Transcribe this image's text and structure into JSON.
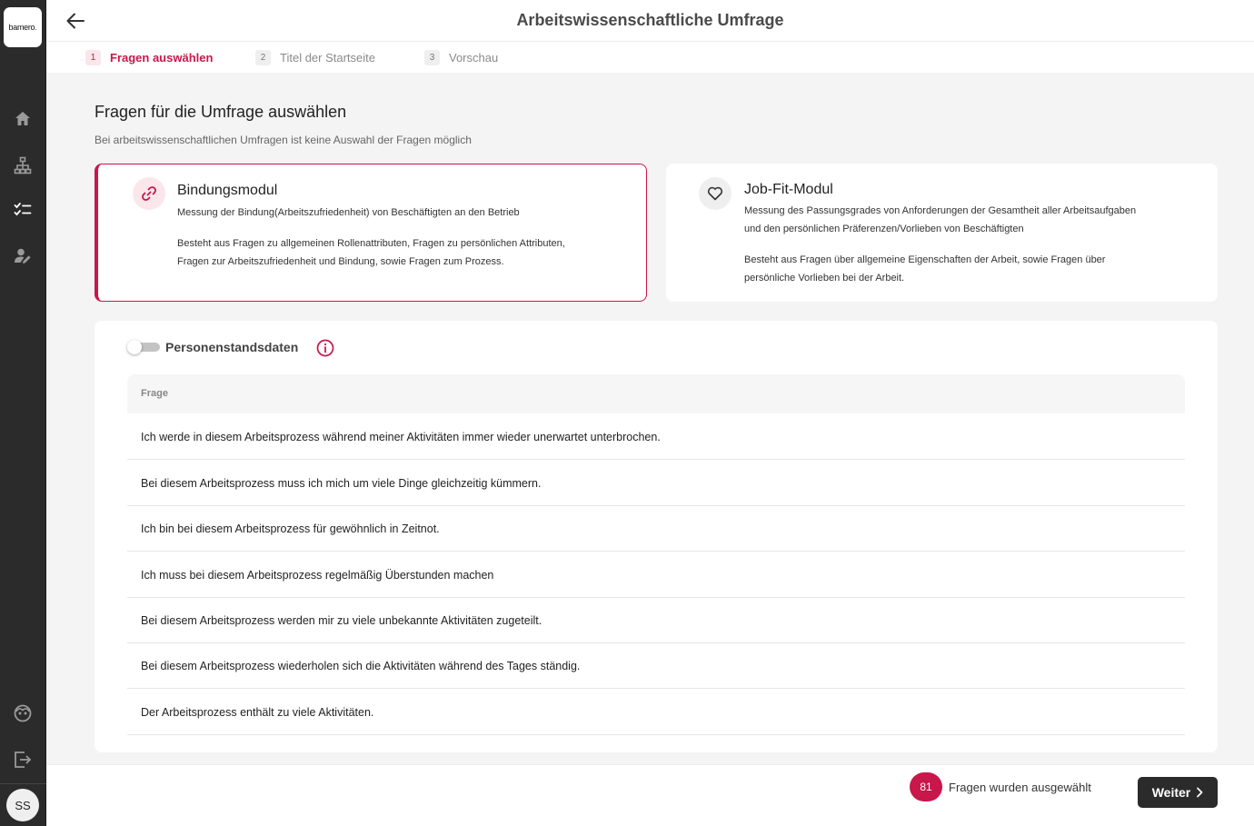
{
  "app": {
    "logo_text": "bamero",
    "user_initials": "SS"
  },
  "sidebar": {
    "items": [
      {
        "name": "home-icon"
      },
      {
        "name": "org-chart-icon"
      },
      {
        "name": "survey-list-icon"
      },
      {
        "name": "user-edit-icon"
      },
      {
        "name": "support-icon"
      },
      {
        "name": "logout-icon"
      }
    ]
  },
  "header": {
    "title": "Arbeitswissenschaftliche Umfrage",
    "back_icon": "arrow-left-icon"
  },
  "stepper": {
    "steps": [
      {
        "number": "1",
        "label": "Fragen auswählen",
        "active": true
      },
      {
        "number": "2",
        "label": "Titel der Startseite",
        "active": false
      },
      {
        "number": "3",
        "label": "Vorschau",
        "active": false
      }
    ]
  },
  "content": {
    "title": "Fragen für die Umfrage auswählen",
    "subtitle": "Bei arbeitswissenschaftlichen Umfragen ist keine Auswahl der Fragen möglich"
  },
  "modules": [
    {
      "title": "Bindungsmodul",
      "icon": "link-icon",
      "selected": true,
      "description": "Messung der Bindung(Arbeitszufriedenheit) von Beschäftigten an den Betrieb",
      "details_line1": "Besteht aus Fragen zu allgemeinen Rollenattributen, Fragen zu persönlichen Attributen,",
      "details_line2": "Fragen zur Arbeitszufriedenheit und Bindung, sowie Fragen zum Prozess."
    },
    {
      "title": "Job-Fit-Modul",
      "icon": "heart-icon",
      "selected": false,
      "description_line1": "Messung des Passungsgrades von Anforderungen der Gesamtheit aller Arbeitsaufgaben",
      "description_line2": "und den persönlichen Präferenzen/Vorlieben von Beschäftigten",
      "details_line1": "Besteht aus Fragen über allgemeine Eigenschaften der Arbeit, sowie Fragen über",
      "details_line2": "persönliche Vorlieben bei der Arbeit."
    }
  ],
  "questions_panel": {
    "toggle_label": "Personenstandsdaten",
    "toggle_on": false,
    "column_header": "Frage",
    "rows": [
      "Ich werde in diesem Arbeitsprozess während meiner Aktivitäten immer wieder unerwartet unterbrochen.",
      "Bei diesem Arbeitsprozess muss ich mich um viele Dinge gleichzeitig kümmern.",
      "Ich bin bei diesem Arbeitsprozess für gewöhnlich in Zeitnot.",
      "Ich muss bei diesem Arbeitsprozess regelmäßig Überstunden machen",
      "Bei diesem Arbeitsprozess werden mir zu viele unbekannte Aktivitäten zugeteilt.",
      "Bei diesem Arbeitsprozess wiederholen sich die Aktivitäten während des Tages ständig.",
      "Der Arbeitsprozess enthält zu viele Aktivitäten."
    ]
  },
  "footer": {
    "count": "81",
    "count_label": "Fragen wurden ausgewählt",
    "next_label": "Weiter"
  },
  "colors": {
    "accent": "#c8174b",
    "sidebar": "#2b2b2b",
    "background": "#f4f4f4"
  }
}
